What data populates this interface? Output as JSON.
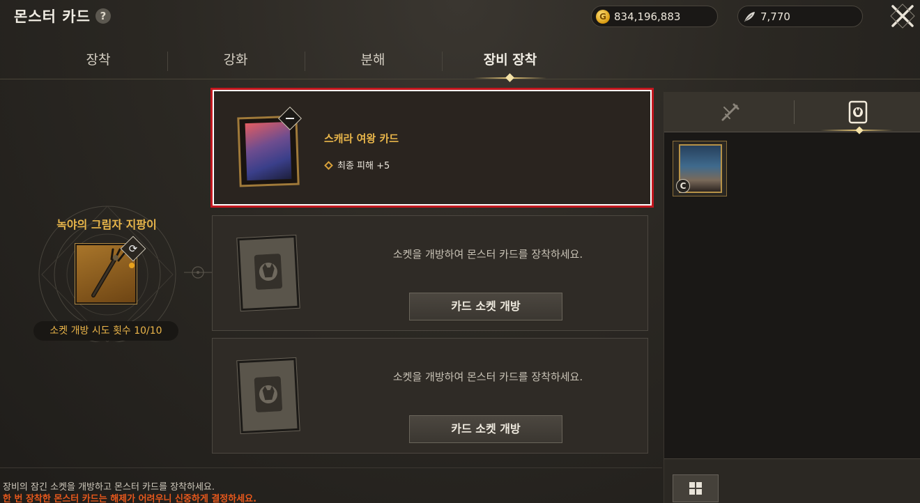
{
  "header": {
    "title": "몬스터 카드",
    "help_label": "?",
    "gold_amount": "834,196,883",
    "gold_icon_glyph": "G",
    "silver_amount": "7,770"
  },
  "tabs": [
    {
      "label": "장착"
    },
    {
      "label": "강화"
    },
    {
      "label": "분해"
    },
    {
      "label": "장비 장착"
    }
  ],
  "active_tab": "장비 장착",
  "equipment": {
    "name": "녹야의 그림자 지팡이",
    "attempts_label": "소켓 개방 시도 횟수 10/10"
  },
  "equipped_card": {
    "name": "스캐라 여왕 카드",
    "effect": "최종 피해 +5"
  },
  "sockets": [
    {
      "message": "소켓을 개방하여 몬스터 카드를 장착하세요.",
      "button_label": "카드 소켓 개방"
    },
    {
      "message": "소켓을 개방하여 몬스터 카드를 장착하세요.",
      "button_label": "카드 소켓 개방"
    }
  ],
  "inventory": {
    "cards": [
      {
        "grade": "C"
      }
    ]
  },
  "footer": {
    "info_line": "장비의 잠긴 소켓을 개방하고 몬스터 카드를 장착하세요.",
    "warning_line": "한 번 장착한 몬스터 카드는 해제가 어려우니 신중하게 결정하세요."
  },
  "colors": {
    "accent_gold": "#e9b64a",
    "warning_orange": "#e7581c",
    "highlight_red": "#c3171f"
  }
}
